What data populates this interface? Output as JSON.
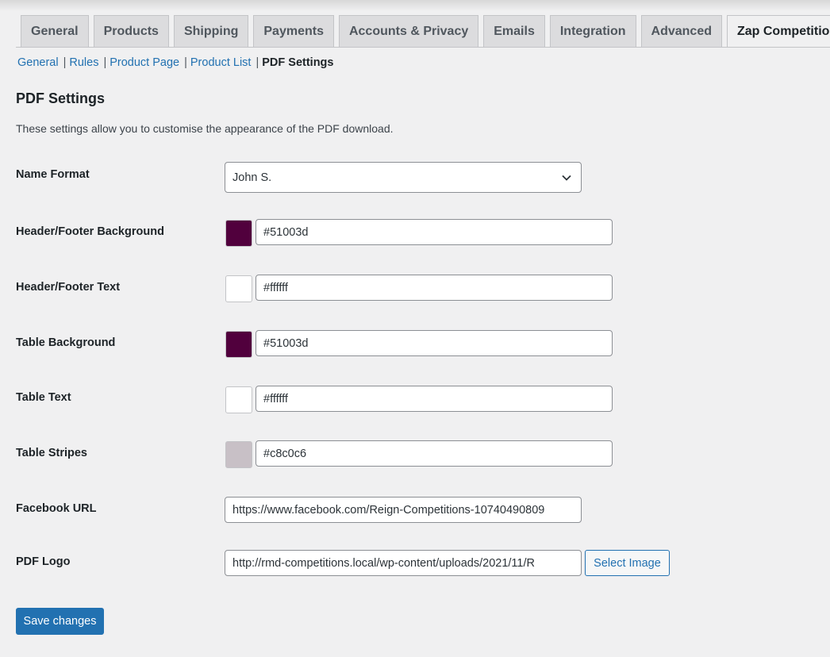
{
  "tabs": [
    {
      "label": "General"
    },
    {
      "label": "Products"
    },
    {
      "label": "Shipping"
    },
    {
      "label": "Payments"
    },
    {
      "label": "Accounts & Privacy"
    },
    {
      "label": "Emails"
    },
    {
      "label": "Integration"
    },
    {
      "label": "Advanced"
    },
    {
      "label": "Zap Competitions"
    }
  ],
  "active_tab": "Zap Competitions",
  "subnav": {
    "general": "General",
    "rules": "Rules",
    "product_page": "Product Page",
    "product_list": "Product List",
    "pdf_settings": "PDF Settings",
    "separator": "|"
  },
  "section": {
    "title": "PDF Settings",
    "description": "These settings allow you to customise the appearance of the PDF download."
  },
  "fields": {
    "name_format": {
      "label": "Name Format",
      "value": "John S."
    },
    "header_footer_bg": {
      "label": "Header/Footer Background",
      "value": "#51003d",
      "swatch": "#51003d"
    },
    "header_footer_text": {
      "label": "Header/Footer Text",
      "value": "#ffffff",
      "swatch": "#ffffff"
    },
    "table_bg": {
      "label": "Table Background",
      "value": "#51003d",
      "swatch": "#51003d"
    },
    "table_text": {
      "label": "Table Text",
      "value": "#ffffff",
      "swatch": "#ffffff"
    },
    "table_stripes": {
      "label": "Table Stripes",
      "value": "#c8c0c6",
      "swatch": "#c8c0c6"
    },
    "facebook_url": {
      "label": "Facebook URL",
      "value": "https://www.facebook.com/Reign-Competitions-10740490809"
    },
    "pdf_logo": {
      "label": "PDF Logo",
      "value": "http://rmd-competitions.local/wp-content/uploads/2021/11/R"
    }
  },
  "buttons": {
    "select_image": "Select Image",
    "save": "Save changes"
  },
  "colors": {
    "accent": "#2271b1",
    "background": "#f0f0f1"
  }
}
